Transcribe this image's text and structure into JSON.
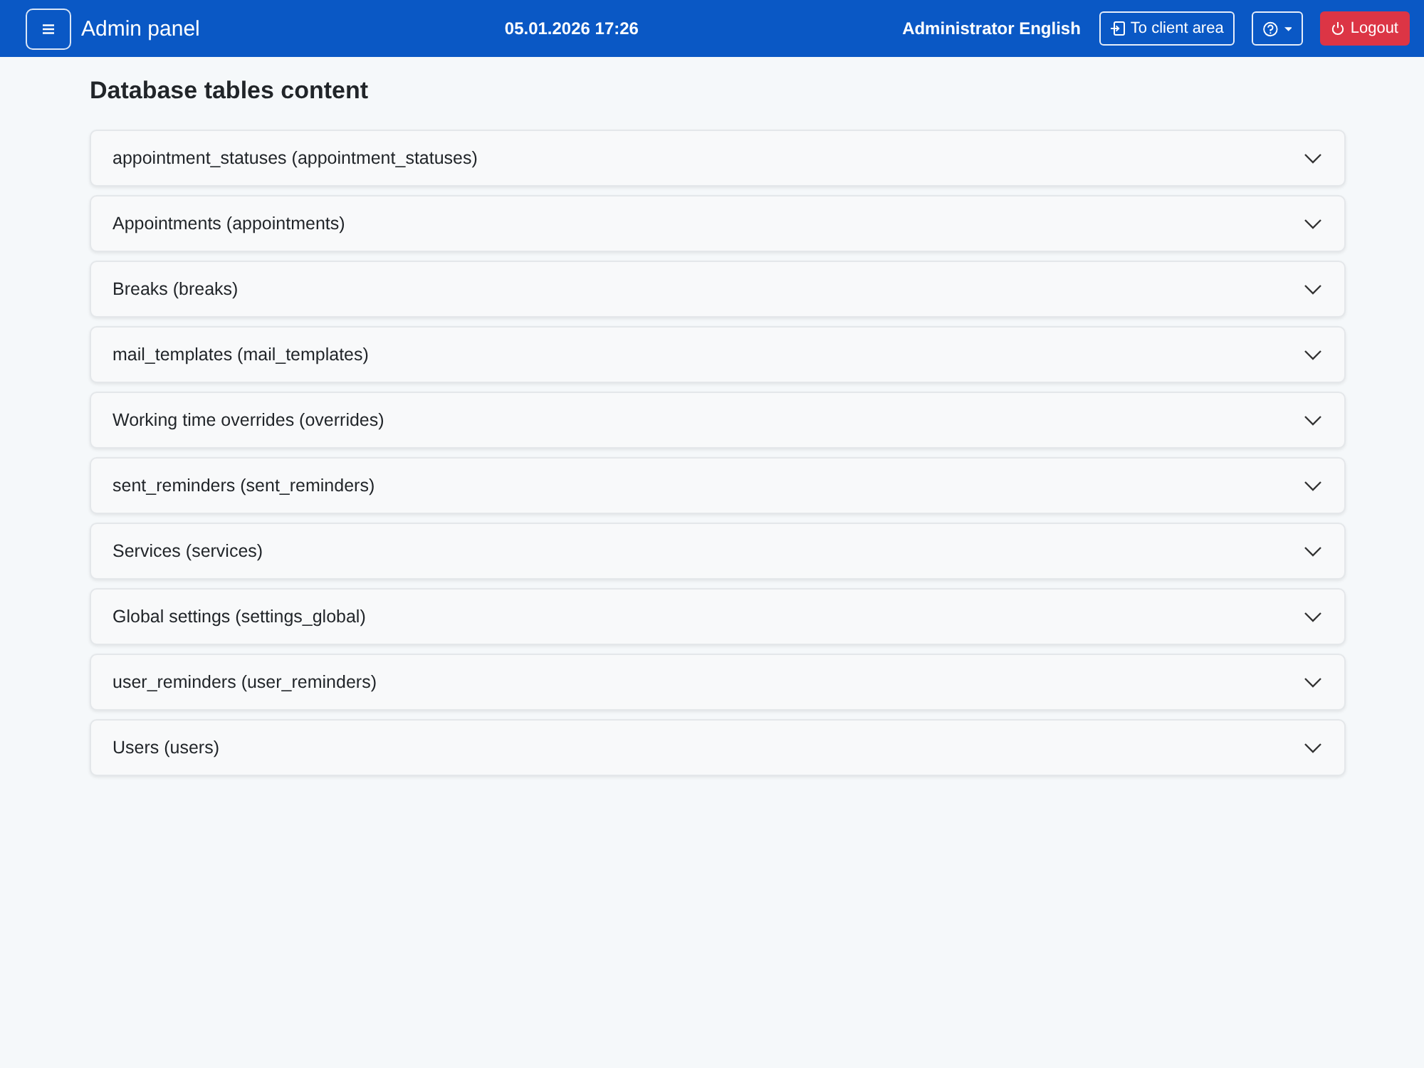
{
  "navbar": {
    "brand": "Admin panel",
    "datetime": "05.01.2026 17:26",
    "user": "Administrator English",
    "buttons": [
      {
        "kind": "client",
        "label": "To client area"
      },
      {
        "kind": "help"
      },
      {
        "kind": "logout",
        "label": "Logout"
      }
    ]
  },
  "page": {
    "title": "Database tables content"
  },
  "accordion": [
    {
      "label": "appointment_statuses (appointment_statuses)",
      "expanded": false
    },
    {
      "label": "Appointments (appointments)",
      "expanded": false
    },
    {
      "label": "Breaks (breaks)",
      "expanded": false
    },
    {
      "label": "mail_templates (mail_templates)",
      "expanded": false
    },
    {
      "label": "Working time overrides (overrides)",
      "expanded": false
    },
    {
      "label": "sent_reminders (sent_reminders)",
      "expanded": false
    },
    {
      "label": "Services (services)",
      "expanded": false
    },
    {
      "label": "Global settings (settings_global)",
      "expanded": false
    },
    {
      "label": "user_reminders (user_reminders)",
      "expanded": false
    },
    {
      "label": "Users (users)",
      "expanded": false
    }
  ]
}
